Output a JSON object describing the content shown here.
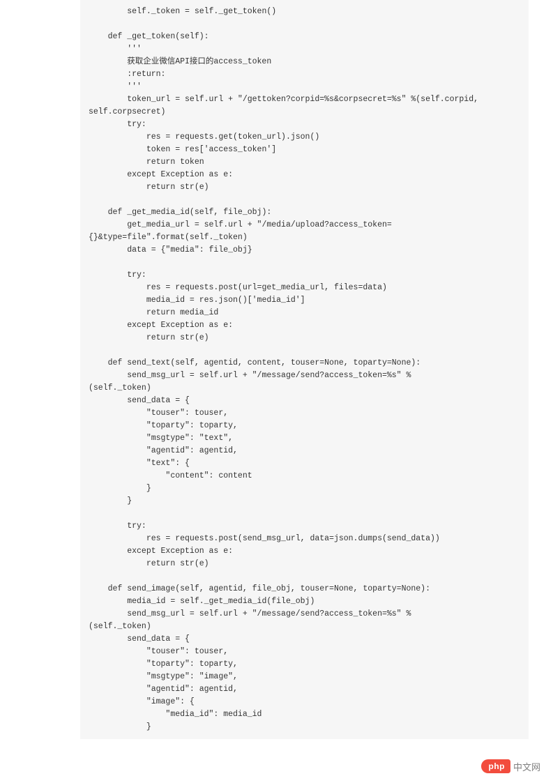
{
  "code": "        self._token = self._get_token()\n\n    def _get_token(self):\n        '''\n        获取企业微信API接口的access_token\n        :return:\n        '''\n        token_url = self.url + \"/gettoken?corpid=%s&corpsecret=%s\" %(self.corpid,\nself.corpsecret)\n        try:\n            res = requests.get(token_url).json()\n            token = res['access_token']\n            return token\n        except Exception as e:\n            return str(e)\n\n    def _get_media_id(self, file_obj):\n        get_media_url = self.url + \"/media/upload?access_token=\n{}&type=file\".format(self._token)\n        data = {\"media\": file_obj}\n\n        try:\n            res = requests.post(url=get_media_url, files=data)\n            media_id = res.json()['media_id']\n            return media_id\n        except Exception as e:\n            return str(e)\n\n    def send_text(self, agentid, content, touser=None, toparty=None):\n        send_msg_url = self.url + \"/message/send?access_token=%s\" %\n(self._token)\n        send_data = {\n            \"touser\": touser,\n            \"toparty\": toparty,\n            \"msgtype\": \"text\",\n            \"agentid\": agentid,\n            \"text\": {\n                \"content\": content\n            }\n        }\n\n        try:\n            res = requests.post(send_msg_url, data=json.dumps(send_data))\n        except Exception as e:\n            return str(e)\n\n    def send_image(self, agentid, file_obj, touser=None, toparty=None):\n        media_id = self._get_media_id(file_obj)\n        send_msg_url = self.url + \"/message/send?access_token=%s\" %\n(self._token)\n        send_data = {\n            \"touser\": touser,\n            \"toparty\": toparty,\n            \"msgtype\": \"image\",\n            \"agentid\": agentid,\n            \"image\": {\n                \"media_id\": media_id\n            }",
  "watermark": {
    "badge": "php",
    "text": "中文网"
  }
}
